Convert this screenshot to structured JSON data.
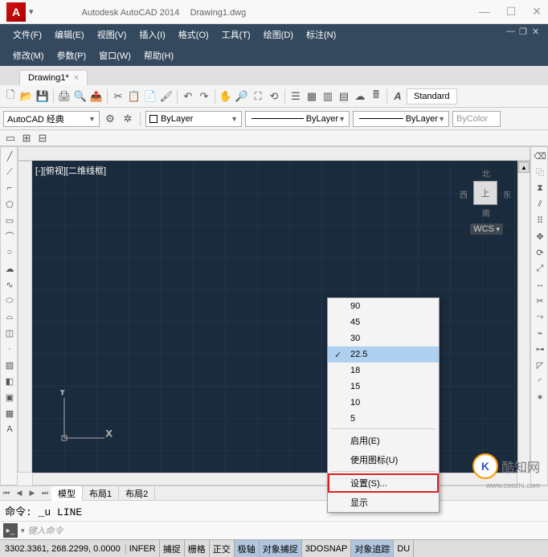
{
  "titlebar": {
    "app": "Autodesk AutoCAD 2014",
    "file": "Drawing1.dwg"
  },
  "menus": {
    "row1": [
      "文件(F)",
      "编辑(E)",
      "视图(V)",
      "插入(I)",
      "格式(O)",
      "工具(T)",
      "绘图(D)",
      "标注(N)"
    ],
    "row2": [
      "修改(M)",
      "参数(P)",
      "窗口(W)",
      "帮助(H)"
    ]
  },
  "filetab": {
    "name": "Drawing1*",
    "close": "×"
  },
  "workspace": "AutoCAD 经典",
  "layer_dropdown": "ByLayer",
  "linetype": "ByLayer",
  "lineweight": "ByLayer",
  "bycolor": "ByColor",
  "textstyle": "Standard",
  "canvas_label": "[-][俯视][二维线框]",
  "viewcube": {
    "n": "北",
    "s": "南",
    "e": "东",
    "w": "西",
    "top": "上"
  },
  "wcs": "WCS",
  "ucs": {
    "x": "X",
    "y": "Y"
  },
  "context_menu": {
    "angles": [
      "90",
      "45",
      "30",
      "22.5",
      "18",
      "15",
      "10",
      "5"
    ],
    "checked": "22.5",
    "enable": "启用(E)",
    "use_icon": "使用图标(U)",
    "settings": "设置(S)...",
    "display": "显示"
  },
  "layout_tabs": [
    "模型",
    "布局1",
    "布局2"
  ],
  "cmdline": {
    "history": "命令: _u LINE",
    "prompt": "▸_",
    "placeholder": "键入命令"
  },
  "statusbar": {
    "coords": "3302.3361, 268.2299, 0.0000",
    "buttons": [
      "INFER",
      "捕捉",
      "栅格",
      "正交",
      "极轴",
      "对象捕捉",
      "3DOSNAP",
      "对象追踪",
      "DU"
    ]
  },
  "watermark": {
    "logo": "K",
    "text": "酷知网",
    "url": "www.coozhi.com"
  }
}
